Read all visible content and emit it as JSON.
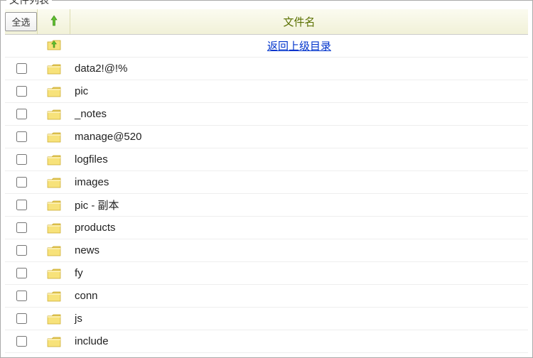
{
  "panel": {
    "title": "文件列表"
  },
  "toolbar": {
    "select_all_label": "全选",
    "column_filename": "文件名"
  },
  "parent_row": {
    "label": "返回上级目录"
  },
  "files": [
    {
      "name": "data2!@!%",
      "type": "folder"
    },
    {
      "name": "pic",
      "type": "folder"
    },
    {
      "name": "_notes",
      "type": "folder"
    },
    {
      "name": "manage@520",
      "type": "folder"
    },
    {
      "name": "logfiles",
      "type": "folder"
    },
    {
      "name": "images",
      "type": "folder"
    },
    {
      "name": "pic - 副本",
      "type": "folder"
    },
    {
      "name": "products",
      "type": "folder"
    },
    {
      "name": "news",
      "type": "folder"
    },
    {
      "name": "fy",
      "type": "folder"
    },
    {
      "name": "conn",
      "type": "folder"
    },
    {
      "name": "js",
      "type": "folder"
    },
    {
      "name": "include",
      "type": "folder"
    }
  ]
}
